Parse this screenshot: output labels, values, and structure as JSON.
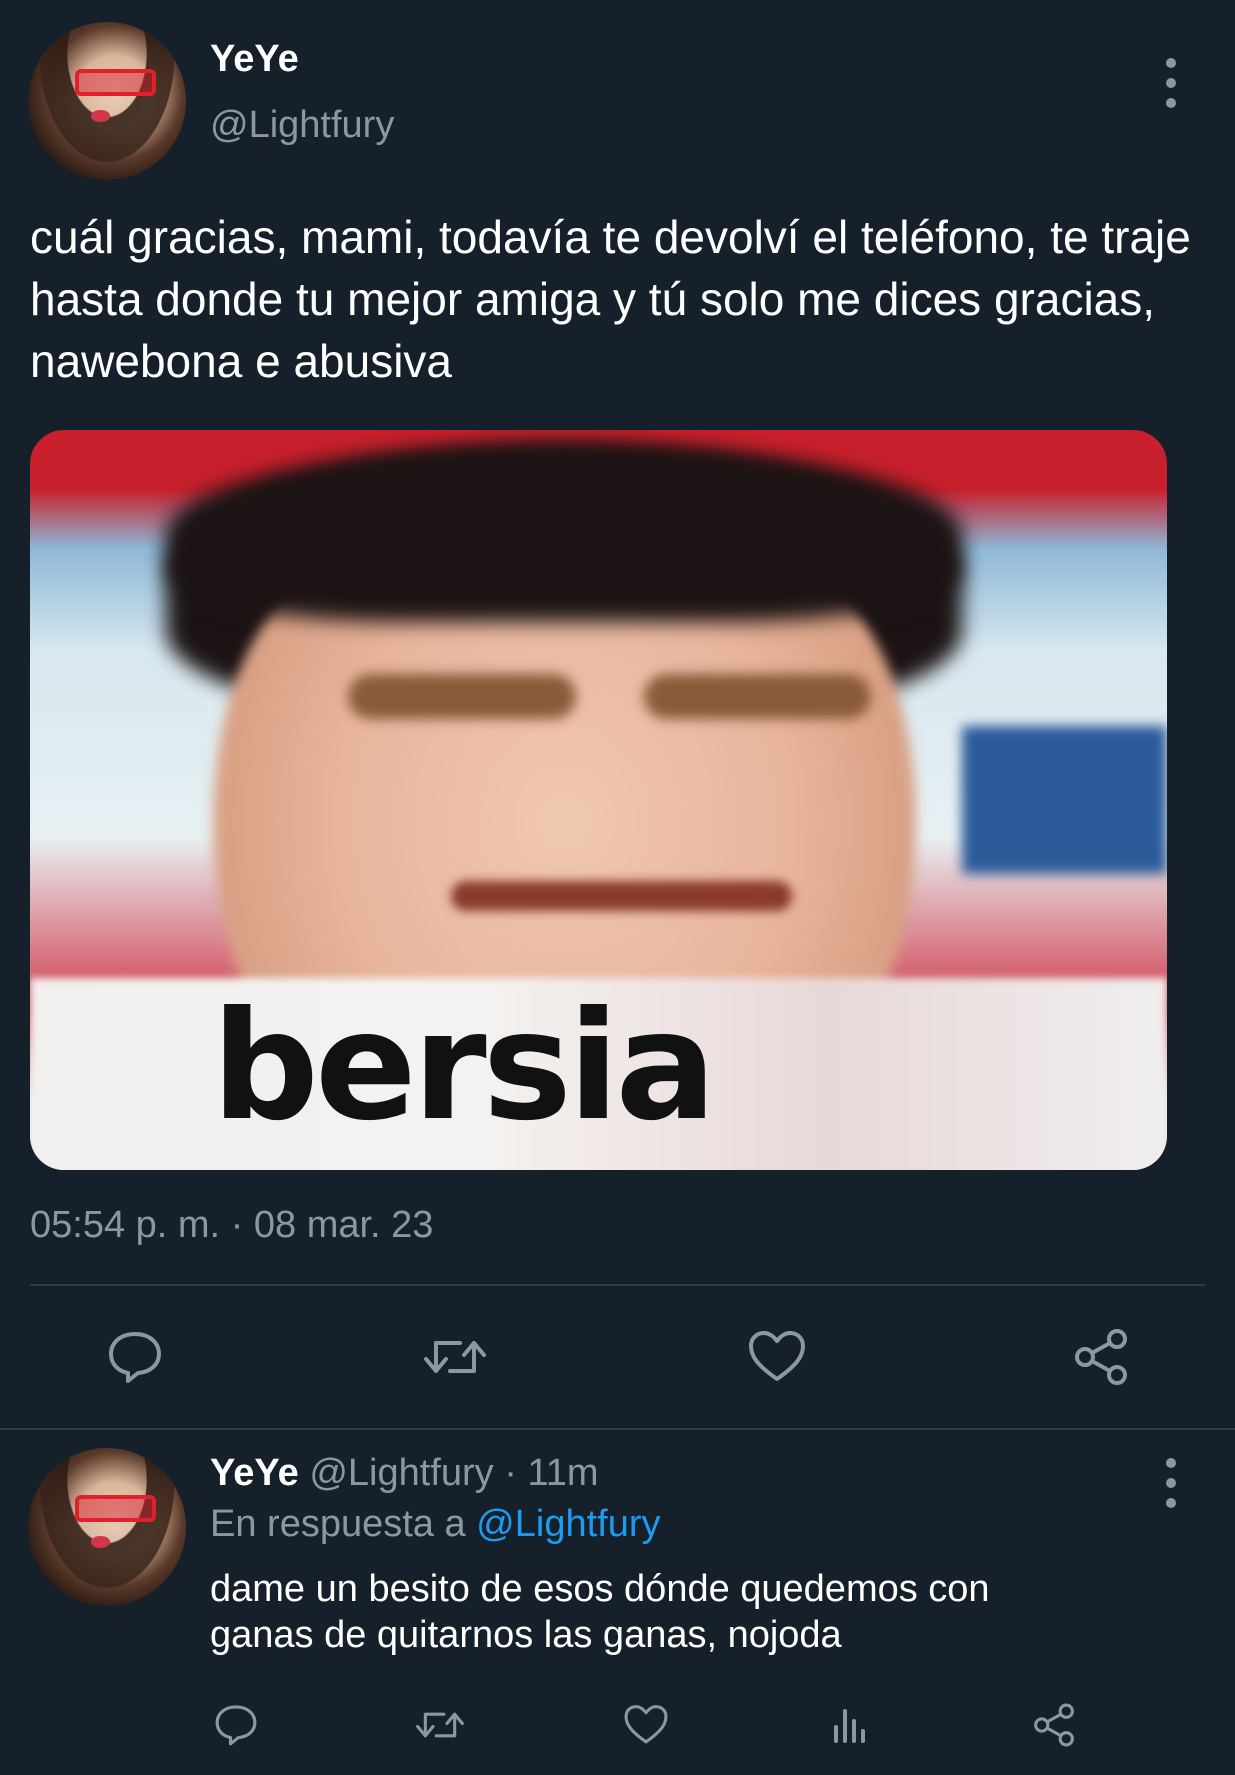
{
  "tweet": {
    "author_name": "YeYe",
    "author_handle": "@Lightfury",
    "text": "cuál gracias, mami, todavía te devolví el teléfono, te traje hasta donde tu mejor amiga y tú solo me dices gracias, nawebona e abusiva",
    "media_caption": "bersia",
    "timestamp": "05:54 p. m. · 08 mar. 23",
    "actions": [
      "reply-icon",
      "retweet-icon",
      "like-icon",
      "share-icon"
    ]
  },
  "reply": {
    "author_name": "YeYe",
    "author_handle": "@Lightfury",
    "time_sep": "·",
    "time": "11m",
    "replying_prefix": "En respuesta a",
    "replying_to": "@Lightfury",
    "text_line1": "dame un besito de esos dónde quedemos con",
    "text_line2": "ganas de quitarnos las ganas, nojoda",
    "actions": [
      "reply-icon",
      "retweet-icon",
      "like-icon",
      "analytics-icon",
      "share-icon"
    ]
  },
  "colors": {
    "background": "#16202b",
    "secondary_text": "#8899a6",
    "link": "#1d9bf0",
    "divider": "#2f3b47"
  }
}
